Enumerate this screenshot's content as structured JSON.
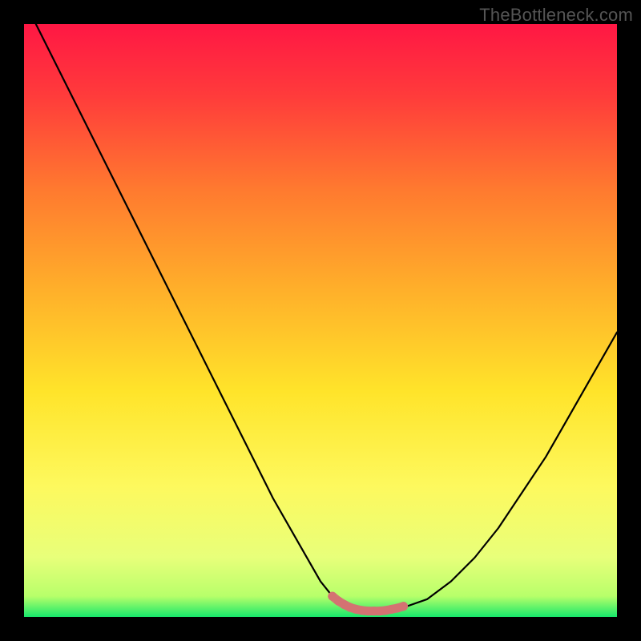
{
  "watermark": "TheBottleneck.com",
  "chart_data": {
    "type": "line",
    "title": "",
    "xlabel": "",
    "ylabel": "",
    "xlim": [
      0,
      100
    ],
    "ylim": [
      0,
      100
    ],
    "background_gradient": {
      "stops": [
        {
          "offset": 0.0,
          "color": "#ff1744"
        },
        {
          "offset": 0.12,
          "color": "#ff3b3b"
        },
        {
          "offset": 0.28,
          "color": "#ff7a2f"
        },
        {
          "offset": 0.45,
          "color": "#ffb02a"
        },
        {
          "offset": 0.62,
          "color": "#ffe42a"
        },
        {
          "offset": 0.78,
          "color": "#fdf95e"
        },
        {
          "offset": 0.9,
          "color": "#e8ff7a"
        },
        {
          "offset": 0.965,
          "color": "#b7ff6a"
        },
        {
          "offset": 1.0,
          "color": "#17e86b"
        }
      ]
    },
    "series": [
      {
        "name": "curve",
        "color": "#000000",
        "x": [
          2,
          6,
          10,
          14,
          18,
          22,
          26,
          30,
          34,
          38,
          42,
          46,
          50,
          52,
          54,
          56,
          58,
          60,
          62,
          64,
          68,
          72,
          76,
          80,
          84,
          88,
          92,
          96,
          100
        ],
        "y": [
          100,
          92,
          84,
          76,
          68,
          60,
          52,
          44,
          36,
          28,
          20,
          13,
          6,
          3.5,
          2,
          1.2,
          1,
          1,
          1.1,
          1.6,
          3,
          6,
          10,
          15,
          21,
          27,
          34,
          41,
          48
        ]
      },
      {
        "name": "highlight",
        "color": "#d47272",
        "type": "marker-band",
        "x": [
          52,
          53,
          54,
          55,
          56,
          57,
          58,
          59,
          60,
          61,
          62,
          63,
          64
        ],
        "y": [
          3.5,
          2.7,
          2.1,
          1.6,
          1.3,
          1.1,
          1.0,
          1.0,
          1.0,
          1.1,
          1.3,
          1.5,
          1.8
        ]
      }
    ]
  }
}
